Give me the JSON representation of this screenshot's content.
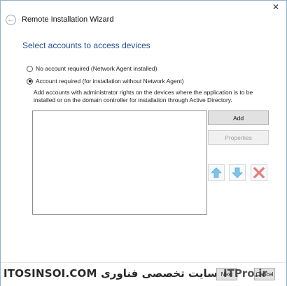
{
  "window": {
    "title": "Remote Installation Wizard",
    "close_glyph": "✕",
    "back_glyph": "←"
  },
  "page": {
    "heading": "Select accounts to access devices",
    "option_no_account": "No account required (Network Agent installed)",
    "option_account_required": "Account required (for installation without Network Agent)",
    "selected_option": "account_required",
    "description": "Add accounts with administrator rights on the devices where the application is to be installed or on the domain controller for installation through Active Directory."
  },
  "buttons": {
    "add": "Add",
    "properties": "Properties",
    "next": "Next",
    "cancel": "Cancel"
  },
  "icons": {
    "move_up": "arrow-up-icon",
    "move_down": "arrow-down-icon",
    "remove": "delete-x-icon",
    "accent_blue": "#7fc3e8",
    "accent_red": "#e87b7b"
  },
  "footer": {
    "watermark_left": "ITOSINSOI.COM",
    "watermark_arabic": "وب سایت تخصصی فناوری",
    "watermark_right": "ITPro.ir"
  }
}
